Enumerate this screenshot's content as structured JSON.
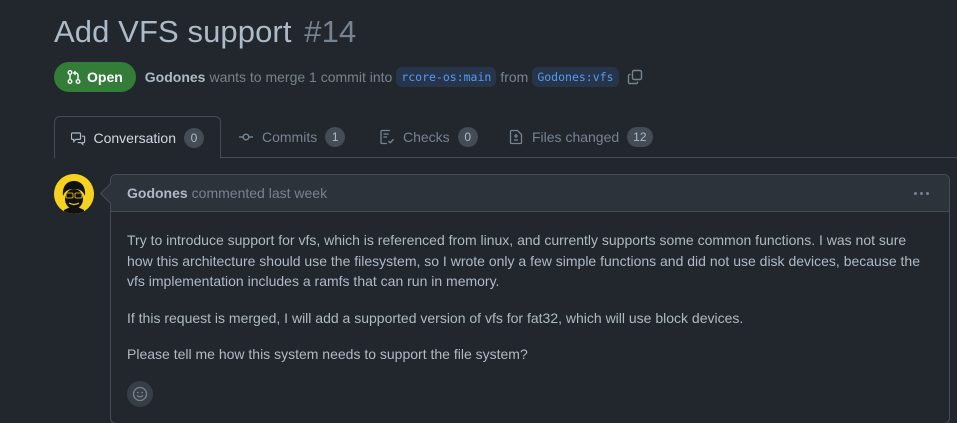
{
  "pr": {
    "title": "Add VFS support",
    "number": "#14",
    "state": "Open",
    "author": "Godones",
    "merge_text": "wants to merge 1 commit into",
    "base_branch": "rcore-os:main",
    "from_text": "from",
    "head_branch": "Godones:vfs"
  },
  "tabs": [
    {
      "label": "Conversation",
      "count": "0",
      "icon": "comment-discussion-icon"
    },
    {
      "label": "Commits",
      "count": "1",
      "icon": "git-commit-icon"
    },
    {
      "label": "Checks",
      "count": "0",
      "icon": "checklist-icon"
    },
    {
      "label": "Files changed",
      "count": "12",
      "icon": "file-diff-icon"
    }
  ],
  "comment": {
    "author": "Godones",
    "meta": "commented last week",
    "paragraphs": [
      "Try to introduce support for vfs, which is referenced from linux, and currently supports some common functions. I was not sure how this architecture should use the filesystem, so I wrote only a few simple functions and did not use disk devices, because the vfs implementation includes a ramfs that can run in memory.",
      "If this request is merged, I will add a supported version of vfs for fat32, which will use block devices.",
      "Please tell me how this system needs to support the file system?"
    ]
  },
  "colors": {
    "background": "#22272e",
    "open_badge": "#347d39",
    "branch_text": "#539bf5",
    "avatar_bg": "#f4d21f"
  }
}
